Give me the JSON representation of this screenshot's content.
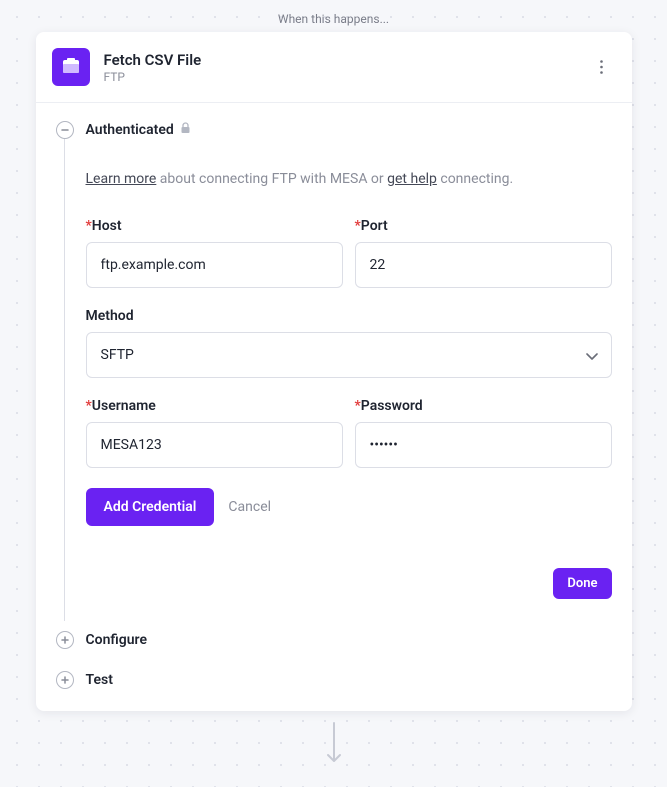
{
  "colors": {
    "accent": "#6a22f2"
  },
  "top_label": "When this happens...",
  "header": {
    "title": "Fetch CSV File",
    "subtitle": "FTP",
    "icon": "folder-ftp-icon"
  },
  "sections": {
    "authenticated": {
      "label": "Authenticated",
      "help": {
        "learn_more": "Learn more",
        "middle": " about connecting FTP with MESA or ",
        "get_help": "get help",
        "suffix": " connecting."
      },
      "fields": {
        "host": {
          "label": "Host",
          "value": "ftp.example.com",
          "required": true
        },
        "port": {
          "label": "Port",
          "value": "22",
          "required": true
        },
        "method": {
          "label": "Method",
          "value": "SFTP",
          "required": false
        },
        "username": {
          "label": "Username",
          "value": "MESA123",
          "required": true
        },
        "password": {
          "label": "Password",
          "value": "••••••",
          "required": true
        }
      },
      "actions": {
        "add_credential": "Add Credential",
        "cancel": "Cancel",
        "done": "Done"
      }
    },
    "configure": {
      "label": "Configure"
    },
    "test": {
      "label": "Test"
    }
  }
}
